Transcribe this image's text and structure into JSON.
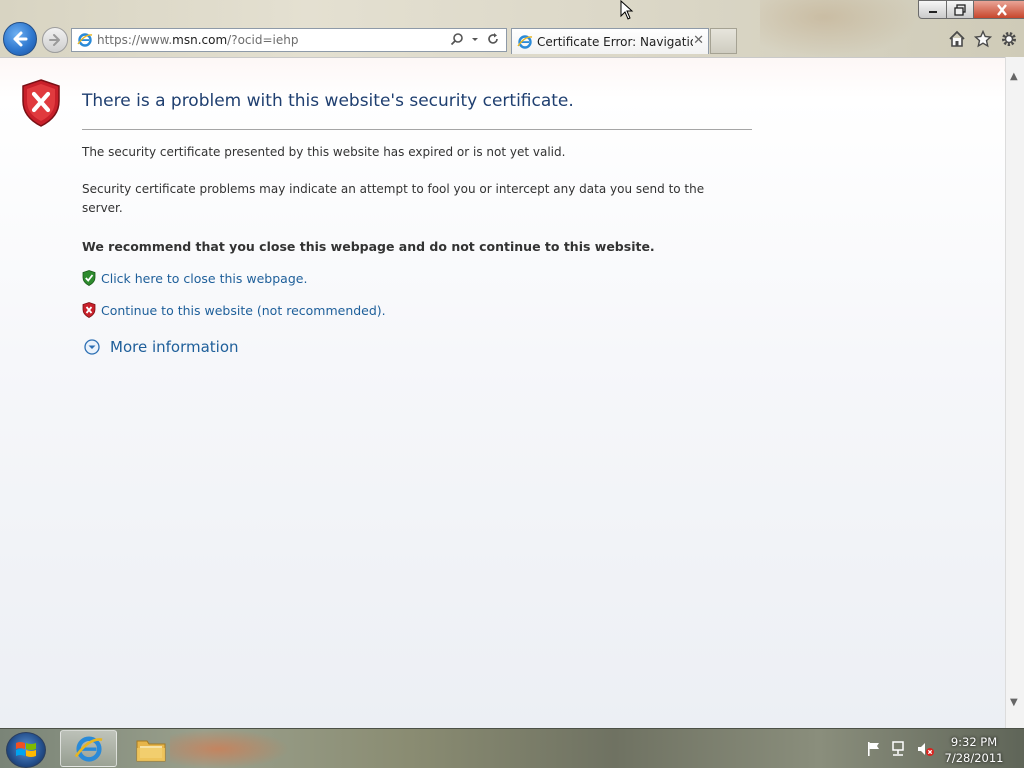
{
  "browser": {
    "address_url_prefix": "https://www.",
    "address_url_domain": "msn.com",
    "address_url_suffix": "/?ocid=iehp",
    "tab_title": "Certificate Error: Navigation..."
  },
  "error_page": {
    "title": "There is a problem with this website's security certificate.",
    "paragraph1": "The security certificate presented by this website has expired or is not yet valid.",
    "paragraph2": "Security certificate problems may indicate an attempt to fool you or intercept any data you send to the server.",
    "recommendation": "We recommend that you close this webpage and do not continue to this website.",
    "close_link": "Click here to close this webpage.",
    "continue_link": "Continue to this website (not recommended).",
    "more_info": "More information"
  },
  "taskbar": {
    "time": "9:32 PM",
    "date": "7/28/2011"
  },
  "icons": [
    "back-arrow-icon",
    "forward-arrow-icon",
    "ie-icon",
    "search-icon",
    "dropdown-icon",
    "refresh-icon",
    "close-icon",
    "home-icon",
    "star-icon",
    "gear-icon",
    "minimize-icon",
    "maximize-icon",
    "shield-error-icon",
    "shield-check-icon",
    "expand-icon",
    "windows-logo-icon",
    "folder-icon",
    "flag-icon",
    "network-icon",
    "volume-muted-icon",
    "mouse-cursor-icon"
  ],
  "colors": {
    "title_text": "#1f3f70",
    "link_text": "#1e5f9a",
    "error_red": "#c8202a",
    "safe_green": "#2e8b2e"
  }
}
